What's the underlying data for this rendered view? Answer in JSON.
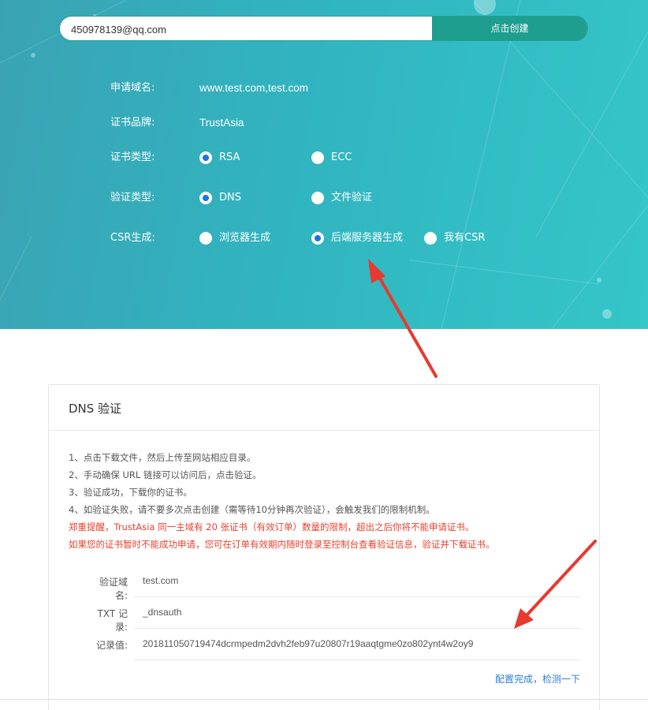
{
  "header": {
    "email_value": "450978139@qq.com",
    "create_button": "点击创建"
  },
  "form": {
    "domain": {
      "label": "申请域名:",
      "value": "www.test.com,test.com"
    },
    "brand": {
      "label": "证书品牌:",
      "value": "TrustAsia"
    },
    "cert_type": {
      "label": "证书类型:",
      "options": [
        {
          "label": "RSA",
          "checked": true
        },
        {
          "label": "ECC",
          "checked": false
        }
      ]
    },
    "verify_type": {
      "label": "验证类型:",
      "options": [
        {
          "label": "DNS",
          "checked": true
        },
        {
          "label": "文件验证",
          "checked": false
        }
      ]
    },
    "csr": {
      "label": "CSR生成:",
      "options": [
        {
          "label": "浏览器生成",
          "checked": false
        },
        {
          "label": "后端服务器生成",
          "checked": true
        },
        {
          "label": "我有CSR",
          "checked": false
        }
      ]
    }
  },
  "dns_card": {
    "title": "DNS 验证",
    "instructions": [
      "1、点击下载文件，然后上传至网站相应目录。",
      "2、手动确保 URL 链接可以访问后，点击验证。",
      "3、验证成功，下载你的证书。",
      "4、如验证失败，请不要多次点击创建（需等待10分钟再次验证），会触发我们的限制机制。"
    ],
    "warnings": [
      "郑重提醒，TrustAsia 同一主域有 20 张证书（有效订单）数量的限制，超出之后你将不能申请证书。",
      "如果您的证书暂时不能成功申请，您可在订单有效期内随时登录至控制台查看验证信息，验证并下载证书。"
    ],
    "records": [
      {
        "label": "验证域名:",
        "value": "test.com"
      },
      {
        "label": "TXT 记录:",
        "value": "_dnsauth"
      },
      {
        "label": "记录值:",
        "value": "201811050719474dcrmpedm2dvh2feb97u20807r19aaqtgme0zo802ynt4w2oy9"
      }
    ],
    "check_link": "配置完成，检测一下"
  },
  "colors": {
    "hero_start": "#3aa3b3",
    "hero_end": "#34c6c8",
    "button": "#1e9e8e",
    "warning": "#e8412c",
    "link": "#2d7ed8",
    "radio_checked": "#1a73e8",
    "annotation_arrow": "#e8392f"
  }
}
